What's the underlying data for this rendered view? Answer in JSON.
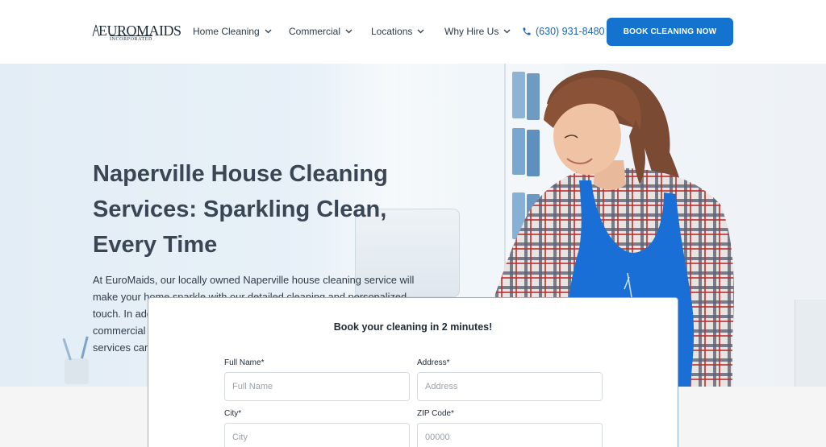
{
  "header": {
    "logo_text": "EUROMAIDS",
    "logo_subtext": "INCORPORATED",
    "nav": [
      {
        "label": "Home Cleaning"
      },
      {
        "label": "Commercial"
      },
      {
        "label": "Locations"
      },
      {
        "label": "Why Hire Us"
      }
    ],
    "phone": "(630) 931-8480",
    "cta_label": "BOOK CLEANING NOW"
  },
  "hero": {
    "title": "Naperville House Cleaning Services: Sparkling Clean, Every Time",
    "description": "At EuroMaids, our locally owned Naperville house cleaning service will make your home sparkle with our detailed cleaning and personalized touch. In addition, we happily handle professional cleaning jobs for commercial spaces and offices in Naperville, IL. See how our maid services can help!"
  },
  "form": {
    "title": "Book your cleaning in 2 minutes!",
    "fields": {
      "full_name": {
        "label": "Full Name*",
        "placeholder": "Full Name",
        "value": ""
      },
      "address": {
        "label": "Address*",
        "placeholder": "Address",
        "value": ""
      },
      "city": {
        "label": "City*",
        "placeholder": "City",
        "value": ""
      },
      "zip": {
        "label": "ZIP Code*",
        "placeholder": "00000",
        "value": ""
      }
    }
  },
  "colors": {
    "accent": "#1573d0",
    "phone_text": "#1565c0",
    "heading": "#3a4654",
    "apron": "#1a6fd6"
  },
  "icons": {
    "phone": "phone-icon",
    "chevron": "chevron-down-icon"
  }
}
